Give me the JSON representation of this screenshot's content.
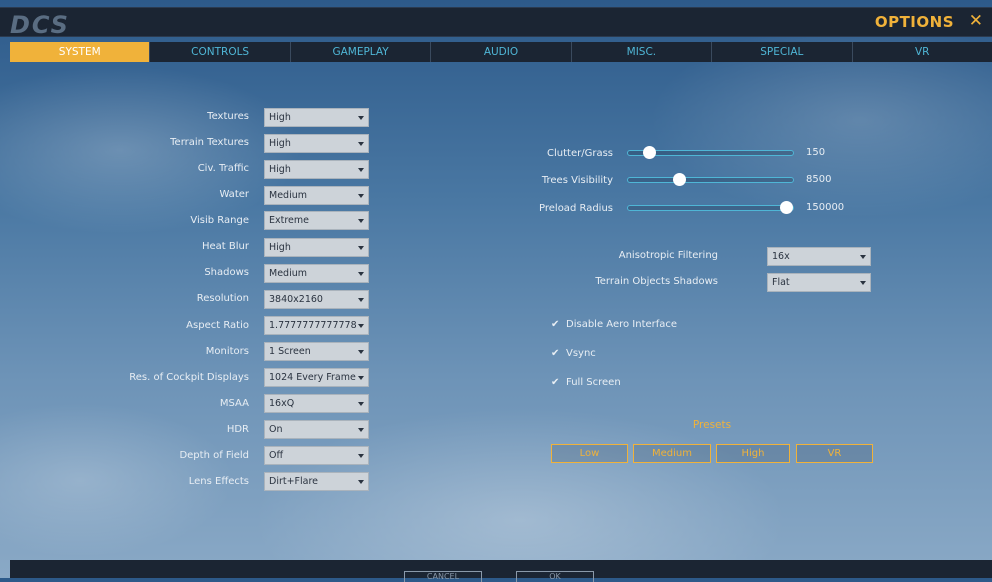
{
  "header": {
    "logo": "DCS",
    "title": "OPTIONS",
    "close_glyph": "✕"
  },
  "tabs": [
    "SYSTEM",
    "CONTROLS",
    "GAMEPLAY",
    "AUDIO",
    "MISC.",
    "SPECIAL",
    "VR"
  ],
  "active_tab": "SYSTEM",
  "settings": [
    {
      "label": "Textures",
      "value": "High"
    },
    {
      "label": "Terrain Textures",
      "value": "High"
    },
    {
      "label": "Civ. Traffic",
      "value": "High"
    },
    {
      "label": "Water",
      "value": "Medium"
    },
    {
      "label": "Visib Range",
      "value": "Extreme"
    },
    {
      "label": "Heat Blur",
      "value": "High"
    },
    {
      "label": "Shadows",
      "value": "Medium"
    },
    {
      "label": "Resolution",
      "value": "3840x2160"
    },
    {
      "label": "Aspect Ratio",
      "value": "1.7777777777778"
    },
    {
      "label": "Monitors",
      "value": "1 Screen"
    },
    {
      "label": "Res. of Cockpit Displays",
      "value": "1024 Every Frame"
    },
    {
      "label": "MSAA",
      "value": "16xQ"
    },
    {
      "label": "HDR",
      "value": "On"
    },
    {
      "label": "Depth of Field",
      "value": "Off"
    },
    {
      "label": "Lens Effects",
      "value": "Dirt+Flare"
    }
  ],
  "sliders": [
    {
      "label": "Clutter/Grass",
      "value": "150",
      "fraction": 0.13
    },
    {
      "label": "Trees Visibility",
      "value": "8500",
      "fraction": 0.31
    },
    {
      "label": "Preload Radius",
      "value": "150000",
      "fraction": 0.96
    }
  ],
  "right_dropdowns": [
    {
      "label": "Anisotropic Filtering",
      "value": "16x"
    },
    {
      "label": "Terrain Objects Shadows",
      "value": "Flat"
    }
  ],
  "checkboxes": [
    {
      "label": "Disable Aero Interface",
      "checked": true
    },
    {
      "label": "Vsync",
      "checked": true
    },
    {
      "label": "Full Screen",
      "checked": true
    }
  ],
  "presets": {
    "title": "Presets",
    "buttons": [
      "Low",
      "Medium",
      "High",
      "VR"
    ]
  },
  "bottom_buttons": [
    "CANCEL",
    "OK"
  ],
  "colors": {
    "accent": "#f0b23a",
    "tab_text": "#4fb6d6",
    "bar_bg": "#1b2533"
  }
}
